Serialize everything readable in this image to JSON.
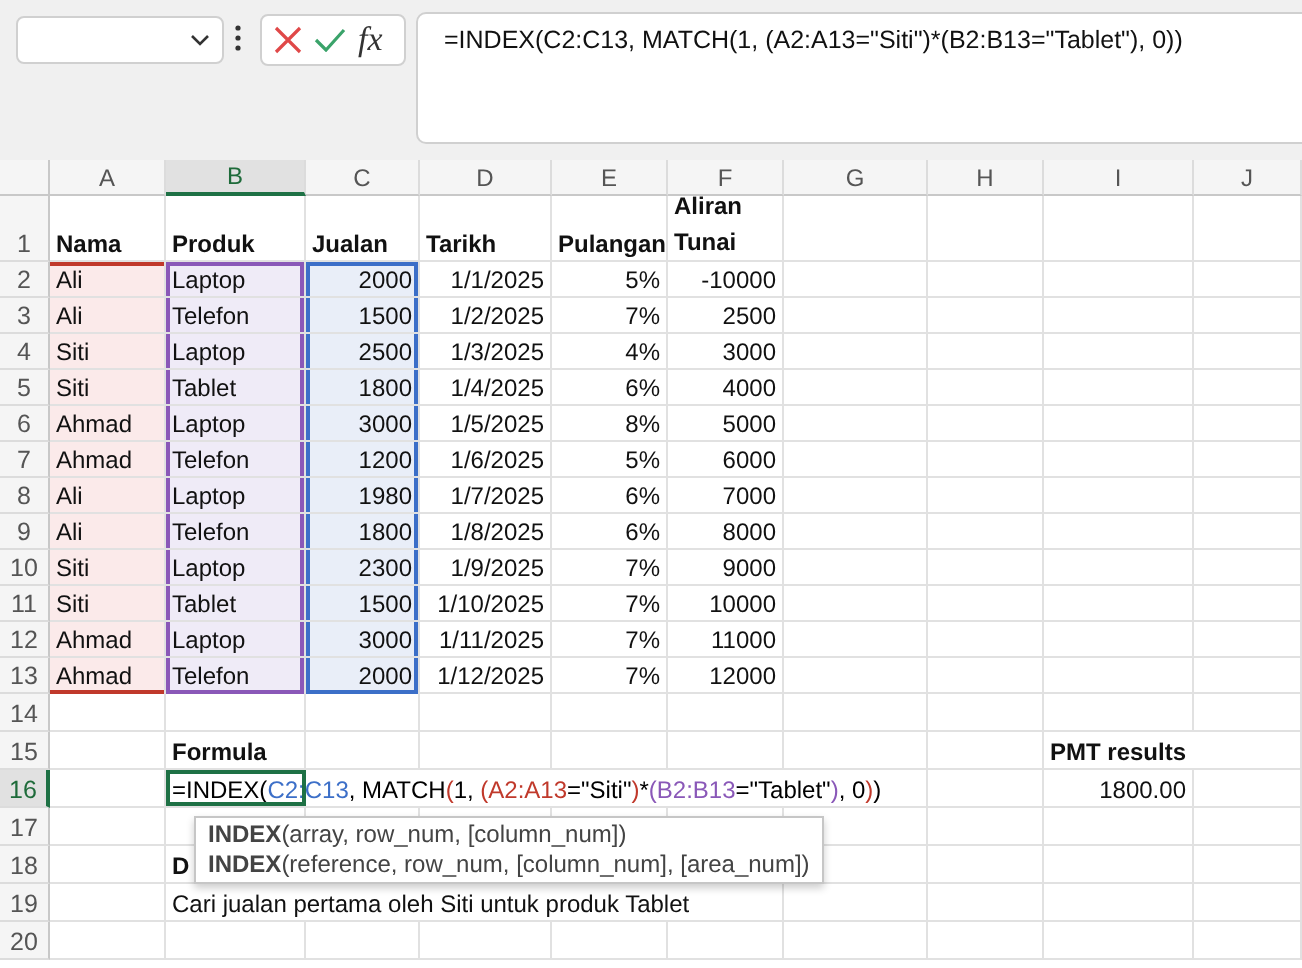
{
  "formula_bar": {
    "fx": "fx",
    "formula": "=INDEX(C2:C13, MATCH(1, (A2:A13=\"Siti\")*(B2:B13=\"Tablet\"), 0))"
  },
  "columns": [
    {
      "label": "A",
      "selected": false
    },
    {
      "label": "B",
      "selected": true
    },
    {
      "label": "C",
      "selected": false
    },
    {
      "label": "D",
      "selected": false
    },
    {
      "label": "E",
      "selected": false
    },
    {
      "label": "F",
      "selected": false
    },
    {
      "label": "G",
      "selected": false
    },
    {
      "label": "H",
      "selected": false
    },
    {
      "label": "I",
      "selected": false
    },
    {
      "label": "J",
      "selected": false
    }
  ],
  "rows": [
    {
      "label": "1",
      "selected": false
    },
    {
      "label": "2",
      "selected": false
    },
    {
      "label": "3",
      "selected": false
    },
    {
      "label": "4",
      "selected": false
    },
    {
      "label": "5",
      "selected": false
    },
    {
      "label": "6",
      "selected": false
    },
    {
      "label": "7",
      "selected": false
    },
    {
      "label": "8",
      "selected": false
    },
    {
      "label": "9",
      "selected": false
    },
    {
      "label": "10",
      "selected": false
    },
    {
      "label": "11",
      "selected": false
    },
    {
      "label": "12",
      "selected": false
    },
    {
      "label": "13",
      "selected": false
    },
    {
      "label": "14",
      "selected": false
    },
    {
      "label": "15",
      "selected": false
    },
    {
      "label": "16",
      "selected": true
    },
    {
      "label": "17",
      "selected": false
    },
    {
      "label": "18",
      "selected": false
    },
    {
      "label": "19",
      "selected": false
    },
    {
      "label": "20",
      "selected": false
    }
  ],
  "table": {
    "header": [
      "Nama",
      "Produk",
      "Jualan",
      "Tarikh",
      "Pulangan",
      "Aliran Tunai"
    ],
    "rows": [
      [
        "Ali",
        "Laptop",
        "2000",
        "1/1/2025",
        "5%",
        "-10000"
      ],
      [
        "Ali",
        "Telefon",
        "1500",
        "1/2/2025",
        "7%",
        "2500"
      ],
      [
        "Siti",
        "Laptop",
        "2500",
        "1/3/2025",
        "4%",
        "3000"
      ],
      [
        "Siti",
        "Tablet",
        "1800",
        "1/4/2025",
        "6%",
        "4000"
      ],
      [
        "Ahmad",
        "Laptop",
        "3000",
        "1/5/2025",
        "8%",
        "5000"
      ],
      [
        "Ahmad",
        "Telefon",
        "1200",
        "1/6/2025",
        "5%",
        "6000"
      ],
      [
        "Ali",
        "Laptop",
        "1980",
        "1/7/2025",
        "6%",
        "7000"
      ],
      [
        "Ali",
        "Telefon",
        "1800",
        "1/8/2025",
        "6%",
        "8000"
      ],
      [
        "Siti",
        "Laptop",
        "2300",
        "1/9/2025",
        "7%",
        "9000"
      ],
      [
        "Siti",
        "Tablet",
        "1500",
        "1/10/2025",
        "7%",
        "10000"
      ],
      [
        "Ahmad",
        "Laptop",
        "3000",
        "1/11/2025",
        "7%",
        "11000"
      ],
      [
        "Ahmad",
        "Telefon",
        "2000",
        "1/12/2025",
        "7%",
        "12000"
      ]
    ]
  },
  "formula_label": "Formula",
  "formula_cell": [
    {
      "text": "=INDEX(",
      "color": "#000000"
    },
    {
      "text": "C2:C13",
      "color": "#3c6fc8"
    },
    {
      "text": ", MATCH",
      "color": "#000000"
    },
    {
      "text": "(",
      "color": "#c0392b"
    },
    {
      "text": "1, ",
      "color": "#000000"
    },
    {
      "text": "(A2:A13",
      "color": "#c0392b"
    },
    {
      "text": "=\"Siti\"",
      "color": "#000000"
    },
    {
      "text": ")",
      "color": "#c0392b"
    },
    {
      "text": "*",
      "color": "#000000"
    },
    {
      "text": "(B2:B13",
      "color": "#8a58b8"
    },
    {
      "text": "=\"Tablet\"",
      "color": "#000000"
    },
    {
      "text": ")",
      "color": "#8a58b8"
    },
    {
      "text": ", 0",
      "color": "#000000"
    },
    {
      "text": ")",
      "color": "#c0392b"
    },
    {
      "text": ")",
      "color": "#000000"
    }
  ],
  "tooltip": [
    "**INDEX**(array, row_num, [column_num])",
    "**INDEX**(reference, row_num, [column_num], [area_num])"
  ],
  "description_heading": "D",
  "description": "Cari jualan pertama oleh Siti untuk produk Tablet",
  "result_label": "PMT results",
  "result": "1800.00"
}
